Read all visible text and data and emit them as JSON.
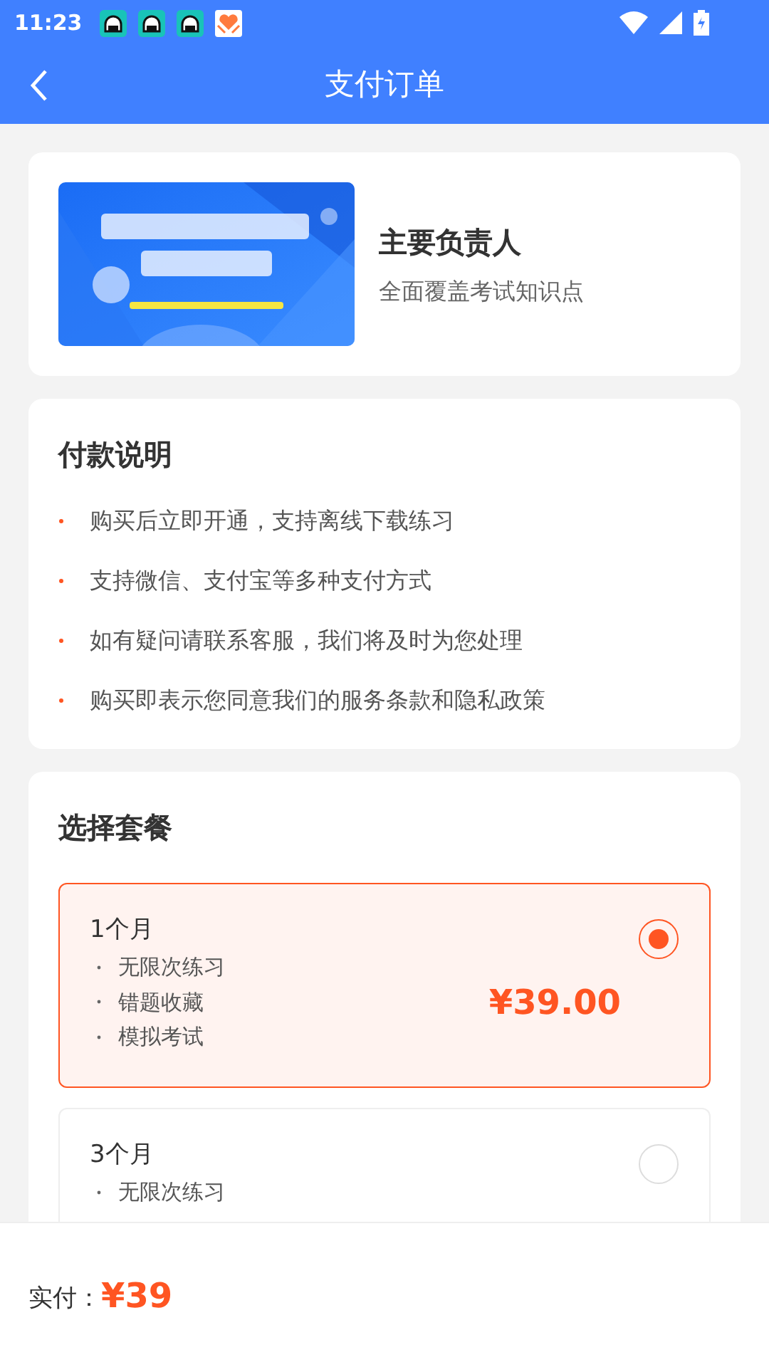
{
  "status_bar": {
    "time": "11:23"
  },
  "header": {
    "title": "支付订单"
  },
  "product": {
    "title": "主要负责人",
    "subtitle": "全面覆盖考试知识点"
  },
  "payment_notes": {
    "title": "付款说明",
    "items": [
      "购买后立即开通，支持离线下载练习",
      "支持微信、支付宝等多种支付方式",
      "如有疑问请联系客服，我们将及时为您处理",
      "购买即表示您同意我们的服务条款和隐私政策"
    ]
  },
  "packages": {
    "title": "选择套餐",
    "items": [
      {
        "name": "1个月",
        "features": [
          "无限次练习",
          "错题收藏",
          "模拟考试"
        ],
        "price": "¥39.00",
        "selected": true
      },
      {
        "name": "3个月",
        "features": [
          "无限次练习"
        ],
        "selected": false
      }
    ]
  },
  "bottom_bar": {
    "label": "实付：",
    "amount": "¥39"
  }
}
